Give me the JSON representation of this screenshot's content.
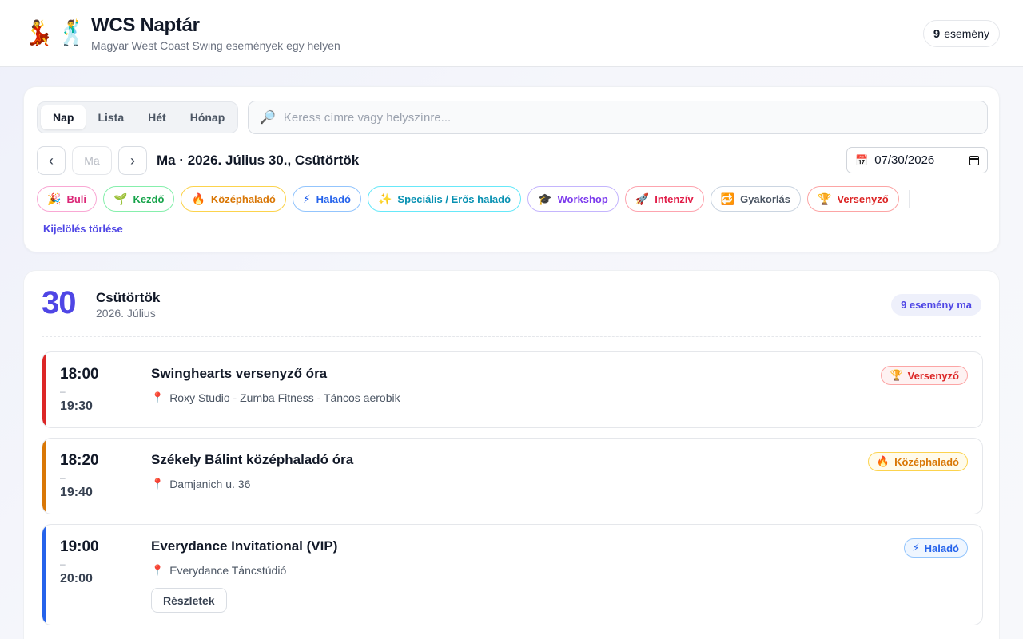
{
  "header": {
    "logo_emojis": [
      "💃",
      "🕺"
    ],
    "title": "WCS Naptár",
    "subtitle": "Magyar West Coast Swing események egy helyen",
    "event_count": "9",
    "event_count_label": "esemény"
  },
  "controls": {
    "tabs": [
      "Nap",
      "Lista",
      "Hét",
      "Hónap"
    ],
    "active_tab": "Nap",
    "search_icon": "🔎",
    "search_placeholder": "Keress címre vagy helyszínre...",
    "prev": "‹",
    "next": "›",
    "today": "Ma",
    "date_heading": "Ma · 2026. Július 30., Csütörtök",
    "date_icon": "📅",
    "date_value": "07/30/2026",
    "filters": [
      {
        "icon": "🎉",
        "label": "Buli",
        "color": "#db2777",
        "border": "#f9a8d4"
      },
      {
        "icon": "🌱",
        "label": "Kezdő",
        "color": "#16a34a",
        "border": "#86efac"
      },
      {
        "icon": "🔥",
        "label": "Középhaladó",
        "color": "#d97706",
        "border": "#fcd34d"
      },
      {
        "icon": "⚡",
        "label": "Haladó",
        "color": "#2563eb",
        "border": "#93c5fd"
      },
      {
        "icon": "✨",
        "label": "Speciális / Erős haladó",
        "color": "#0891b2",
        "border": "#67e8f9"
      },
      {
        "icon": "🎓",
        "label": "Workshop",
        "color": "#7c3aed",
        "border": "#c4b5fd"
      },
      {
        "icon": "🚀",
        "label": "Intenzív",
        "color": "#e11d48",
        "border": "#fda4af"
      },
      {
        "icon": "🔁",
        "label": "Gyakorlás",
        "color": "#4b5563",
        "border": "#cbd5e1"
      },
      {
        "icon": "🏆",
        "label": "Versenyző",
        "color": "#dc2626",
        "border": "#fca5a5"
      }
    ],
    "clear_label": "Kijelölés törlése"
  },
  "day": {
    "number": "30",
    "weekday": "Csütörtök",
    "month": "2026. Július",
    "count_label": "9 esemény ma"
  },
  "events": [
    {
      "start": "18:00",
      "end": "19:30",
      "title": "Swinghearts versenyző óra",
      "location": "Roxy Studio - Zumba Fitness - Táncos aerobik",
      "badge_icon": "🏆",
      "badge": "Versenyző",
      "color": "#dc2626",
      "badge_bg": "#fef2f2",
      "badge_border": "#fca5a5",
      "details": null
    },
    {
      "start": "18:20",
      "end": "19:40",
      "title": "Székely Bálint középhaladó óra",
      "location": "Damjanich u. 36",
      "badge_icon": "🔥",
      "badge": "Középhaladó",
      "color": "#d97706",
      "badge_bg": "#fffbeb",
      "badge_border": "#fcd34d",
      "details": null
    },
    {
      "start": "19:00",
      "end": "20:00",
      "title": "Everydance Invitational (VIP)",
      "location": "Everydance Táncstúdió",
      "badge_icon": "⚡",
      "badge": "Haladó",
      "color": "#2563eb",
      "badge_bg": "#eff6ff",
      "badge_border": "#93c5fd",
      "details": "Részletek"
    }
  ],
  "pin_icon": "📍",
  "dash": "–"
}
